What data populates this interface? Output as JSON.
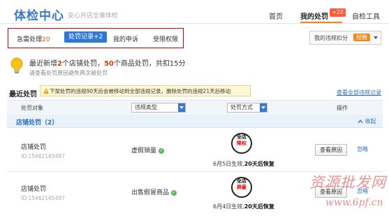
{
  "header": {
    "title": "体检中心",
    "slogan": "安心开店全靠体检",
    "nav": [
      {
        "label": "首页"
      },
      {
        "label": "我的处罚",
        "badge": "+22"
      },
      {
        "label": "自检工具"
      }
    ]
  },
  "tabs": {
    "items": [
      {
        "label": "急需处理",
        "count": "20"
      },
      {
        "label": "处罚记录+2"
      },
      {
        "label": "我的申诉"
      },
      {
        "label": "受限权限"
      }
    ]
  },
  "score": {
    "label": "我的违规扣分",
    "badge": "轻微"
  },
  "summary": {
    "prefix": "最近新增",
    "store_count": "2",
    "mid1": "个店铺处罚，",
    "item_count": "50",
    "mid2": "个商品处罚，共扣15分",
    "hint": "请查看处罚原因避免再次被处罚"
  },
  "recent": {
    "title": "最近处罚",
    "notice": "下架处罚的违规90天后会被移动到全部违规记录，删除处罚的违规21天后移动",
    "view_all": "查看全部违规记录"
  },
  "table": {
    "headers": {
      "object": "处罚对象",
      "type": "违规类型",
      "method": "处罚方式",
      "action": "操作"
    },
    "group": {
      "label": "店铺处罚（2）",
      "collapse": "收起"
    },
    "rows": [
      {
        "name": "店铺处罚",
        "id": "ID:15462165487",
        "type": "虚假销量",
        "stamp_top": "全店",
        "stamp_bottom": "降权",
        "effect_date": "6月5日生效,",
        "effect_days": "20天后恢复",
        "btn": "查看原因",
        "ignore": "忽略"
      },
      {
        "name": "店铺处罚",
        "id": "ID:15462165487",
        "type": "出售假冒商品",
        "stamp_top": "全店",
        "stamp_bottom": "屏蔽",
        "effect_date": "6月4日生效,",
        "effect_days": "20天后恢复",
        "btn": "查看原因",
        "ignore": "忽略"
      }
    ]
  },
  "watermark": {
    "line1": "资源批发网",
    "line2": "www.6pf.cn"
  },
  "colors": {
    "accent": "#2f78d8",
    "highlight_border": "#d40000",
    "badge": "#ff5a3a",
    "warn": "#f08a1c"
  }
}
